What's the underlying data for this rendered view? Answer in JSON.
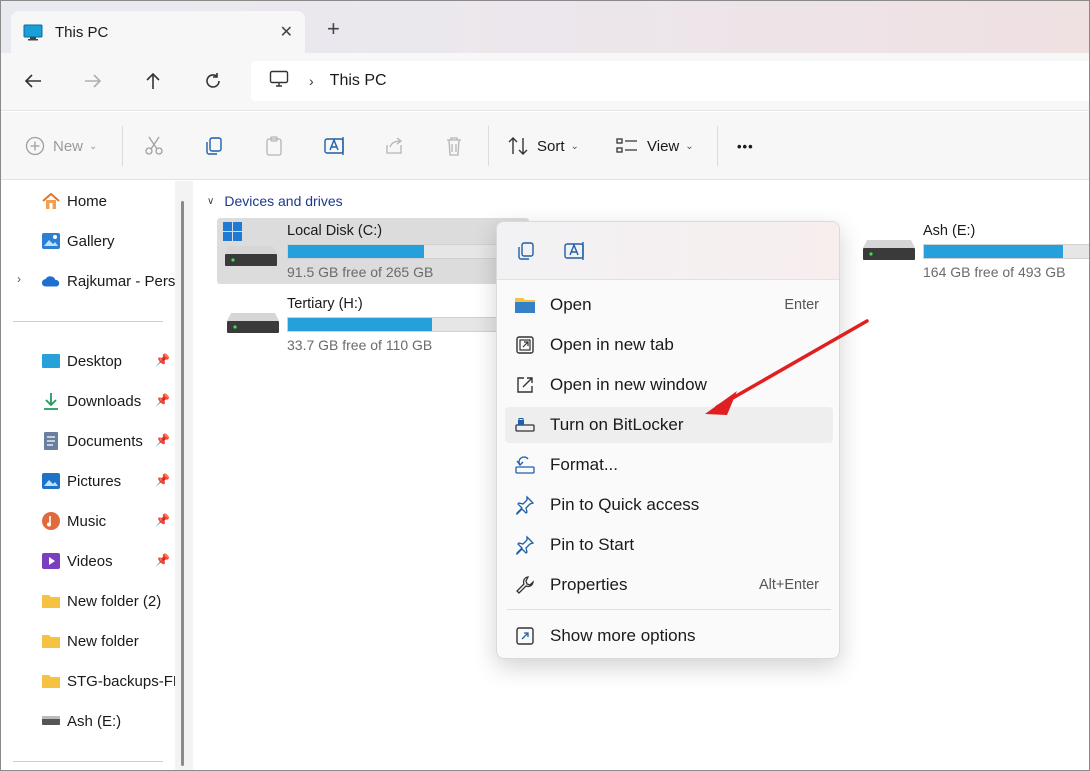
{
  "tab": {
    "title": "This PC",
    "close_glyph": "✕",
    "new_tab_glyph": "+"
  },
  "nav": {
    "breadcrumb": "This PC",
    "separator": "›"
  },
  "toolbar": {
    "new_label": "New",
    "sort_label": "Sort",
    "view_label": "View",
    "more_glyph": "•••"
  },
  "sidebar": {
    "top_items": [
      {
        "label": "Home",
        "icon": "home-icon"
      },
      {
        "label": "Gallery",
        "icon": "gallery-icon"
      },
      {
        "label": "Rajkumar - Perso",
        "icon": "onedrive-icon"
      }
    ],
    "quick_items": [
      {
        "label": "Desktop",
        "icon": "desktop-icon",
        "pinned": true
      },
      {
        "label": "Downloads",
        "icon": "download-icon",
        "pinned": true
      },
      {
        "label": "Documents",
        "icon": "documents-icon",
        "pinned": true
      },
      {
        "label": "Pictures",
        "icon": "pictures-icon",
        "pinned": true
      },
      {
        "label": "Music",
        "icon": "music-icon",
        "pinned": true
      },
      {
        "label": "Videos",
        "icon": "videos-icon",
        "pinned": true
      },
      {
        "label": "New folder (2)",
        "icon": "folder-icon",
        "pinned": false
      },
      {
        "label": "New folder",
        "icon": "folder-icon",
        "pinned": false
      },
      {
        "label": "STG-backups-FF",
        "icon": "folder-icon",
        "pinned": false
      },
      {
        "label": "Ash (E:)",
        "icon": "drive-icon",
        "pinned": false
      }
    ]
  },
  "main": {
    "section_title": "Devices and drives",
    "drives": [
      {
        "name": "Local Disk (C:)",
        "free": "91.5 GB free of 265 GB",
        "used_fraction": 0.655,
        "selected": true,
        "system": true
      },
      {
        "name": "Ash (E:)",
        "free": "164 GB free of 493 GB",
        "used_fraction": 0.667,
        "selected": false,
        "system": false
      },
      {
        "name": "Tertiary (H:)",
        "free": "33.7 GB free of 110 GB",
        "used_fraction": 0.694,
        "selected": false,
        "system": false
      }
    ]
  },
  "context_menu": {
    "items": [
      {
        "label": "Open",
        "shortcut": "Enter",
        "icon": "folder-open-icon"
      },
      {
        "label": "Open in new tab",
        "shortcut": "",
        "icon": "new-tab-icon"
      },
      {
        "label": "Open in new window",
        "shortcut": "",
        "icon": "new-window-icon"
      },
      {
        "label": "Turn on BitLocker",
        "shortcut": "",
        "icon": "bitlocker-icon",
        "hover": true
      },
      {
        "label": "Format...",
        "shortcut": "",
        "icon": "format-icon"
      },
      {
        "label": "Pin to Quick access",
        "shortcut": "",
        "icon": "pin-icon"
      },
      {
        "label": "Pin to Start",
        "shortcut": "",
        "icon": "pin-icon"
      },
      {
        "label": "Properties",
        "shortcut": "Alt+Enter",
        "icon": "properties-icon"
      },
      {
        "label": "Show more options",
        "shortcut": "",
        "icon": "more-options-icon"
      }
    ]
  },
  "colors": {
    "accent": "#26a0da",
    "arrow": "#e02020",
    "section": "#1b3a8a"
  }
}
